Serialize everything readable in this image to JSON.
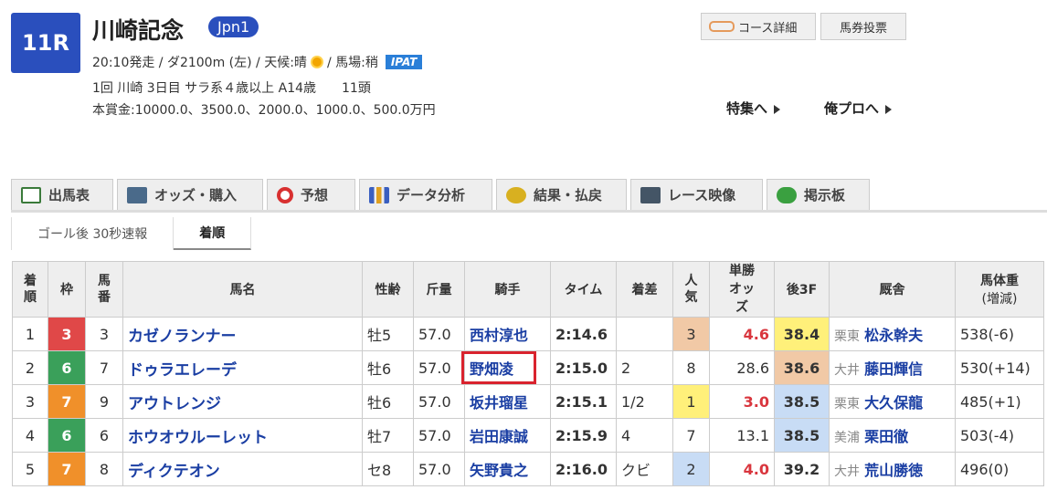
{
  "race": {
    "number": "11R",
    "title": "川崎記念",
    "grade": "Jpn1",
    "info_start": "20:10発走 / ダ2100m (左) / 天候:晴",
    "info_track": " / 馬場:稍",
    "ipat": "IPAT",
    "info_meet": "1回 川崎 3日目 サラ系４歳以上 A14歳　　11頭",
    "prize": "本賞金:10000.0、3500.0、2000.0、1000.0、500.0万円"
  },
  "header_buttons": {
    "course": "コース詳細",
    "vote": "馬券投票"
  },
  "features": {
    "special": "特集へ",
    "orepro": "俺プロへ"
  },
  "tabs": [
    {
      "label": "出馬表",
      "icon": "table-icon",
      "color": "#3a7a3a"
    },
    {
      "label": "オッズ・購入",
      "icon": "ipat-icon",
      "color": "#4a6a8a"
    },
    {
      "label": "予想",
      "icon": "target-icon",
      "color": "#d83030"
    },
    {
      "label": "データ分析",
      "icon": "bar-chart-icon",
      "color": "#3a5fc0"
    },
    {
      "label": "結果・払戻",
      "icon": "coins-icon",
      "color": "#d8b020"
    },
    {
      "label": "レース映像",
      "icon": "video-icon",
      "color": "#445566"
    },
    {
      "label": "掲示板",
      "icon": "chat-icon",
      "color": "#3aa040"
    }
  ],
  "subtabs": [
    "ゴール後 30秒速報",
    "着順"
  ],
  "table": {
    "headers": {
      "rank": "着順",
      "waku": "枠",
      "num": "馬番",
      "name": "馬名",
      "sexage": "性齢",
      "weight": "斤量",
      "jockey": "騎手",
      "time": "タイム",
      "margin": "着差",
      "pop": "人気",
      "odds": "単勝オッズ",
      "f3": "後3F",
      "stable": "厩舎",
      "bw": "馬体重",
      "bw_sub": "(増減)"
    },
    "rows": [
      {
        "rank": "1",
        "waku": "3",
        "waku_color": "#e04848",
        "num": "3",
        "name": "カゼノランナー",
        "sexage": "牡5",
        "weight": "57.0",
        "jockey": "西村淳也",
        "time": "2:14.6",
        "margin": "",
        "pop": "3",
        "pop_bg": "#f1c9a6",
        "odds": "4.6",
        "odds_red": true,
        "f3": "38.4",
        "f3_bg": "#fff07a",
        "region": "栗東",
        "trainer": "松永幹夫",
        "bw": "538(-6)"
      },
      {
        "rank": "2",
        "waku": "6",
        "waku_color": "#3aa05a",
        "num": "7",
        "name": "ドゥラエレーデ",
        "sexage": "牡6",
        "weight": "57.0",
        "jockey": "野畑凌",
        "time": "2:15.0",
        "margin": "2",
        "pop": "8",
        "pop_bg": "",
        "odds": "28.6",
        "odds_red": false,
        "f3": "38.6",
        "f3_bg": "#f1c9a6",
        "region": "大井",
        "trainer": "藤田輝信",
        "bw": "530(+14)"
      },
      {
        "rank": "3",
        "waku": "7",
        "waku_color": "#f0902a",
        "num": "9",
        "name": "アウトレンジ",
        "sexage": "牡6",
        "weight": "57.0",
        "jockey": "坂井瑠星",
        "time": "2:15.1",
        "margin": "1/2",
        "pop": "1",
        "pop_bg": "#fff07a",
        "odds": "3.0",
        "odds_red": true,
        "f3": "38.5",
        "f3_bg": "#c8dcf5",
        "region": "栗東",
        "trainer": "大久保龍",
        "bw": "485(+1)"
      },
      {
        "rank": "4",
        "waku": "6",
        "waku_color": "#3aa05a",
        "num": "6",
        "name": "ホウオウルーレット",
        "sexage": "牡7",
        "weight": "57.0",
        "jockey": "岩田康誠",
        "time": "2:15.9",
        "margin": "4",
        "pop": "7",
        "pop_bg": "",
        "odds": "13.1",
        "odds_red": false,
        "f3": "38.5",
        "f3_bg": "#c8dcf5",
        "region": "美浦",
        "trainer": "栗田徹",
        "bw": "503(-4)"
      },
      {
        "rank": "5",
        "waku": "7",
        "waku_color": "#f0902a",
        "num": "8",
        "name": "ディクテオン",
        "sexage": "セ8",
        "weight": "57.0",
        "jockey": "矢野貴之",
        "time": "2:16.0",
        "margin": "クビ",
        "pop": "2",
        "pop_bg": "#c8dcf5",
        "odds": "4.0",
        "odds_red": true,
        "f3": "39.2",
        "f3_bg": "",
        "region": "大井",
        "trainer": "荒山勝徳",
        "bw": "496(0)"
      }
    ]
  }
}
